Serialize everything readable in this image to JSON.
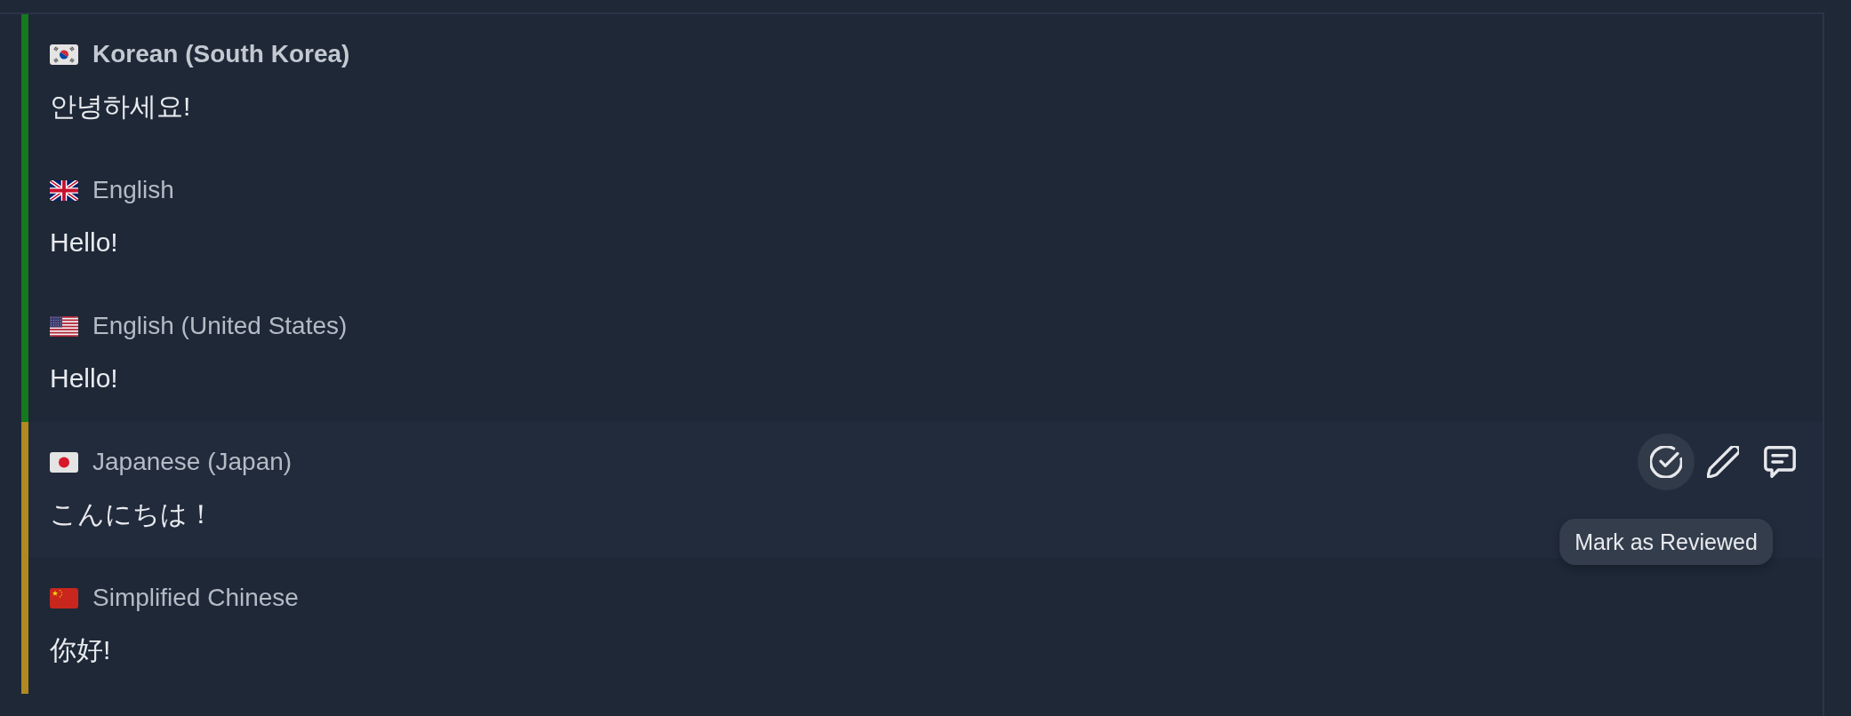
{
  "translations": [
    {
      "flag": {
        "kind": "south-korea"
      },
      "language": "Korean (South Korea)",
      "is_source": true,
      "color": "#16791f",
      "hovered": false,
      "text": "안녕하세요!"
    },
    {
      "flag": {
        "kind": "united-kingdom"
      },
      "language": "English",
      "is_source": false,
      "color": "#16791f",
      "hovered": false,
      "text": "Hello!"
    },
    {
      "flag": {
        "kind": "united-states"
      },
      "language": "English (United States)",
      "is_source": false,
      "color": "#16791f",
      "hovered": false,
      "text": "Hello!"
    },
    {
      "flag": {
        "kind": "japan"
      },
      "language": "Japanese (Japan)",
      "is_source": false,
      "color": "#b08a20",
      "hovered": true,
      "text": "こんにちは！"
    },
    {
      "flag": {
        "kind": "china"
      },
      "language": "Simplified Chinese",
      "is_source": false,
      "color": "#b08a20",
      "hovered": false,
      "text": "你好!"
    }
  ],
  "row_actions": {
    "buttons": [
      {
        "kind": "mark-reviewed",
        "hovered": true
      },
      {
        "kind": "edit",
        "hovered": false
      },
      {
        "kind": "comment",
        "hovered": false
      }
    ],
    "tooltip": "Mark as Reviewed"
  }
}
